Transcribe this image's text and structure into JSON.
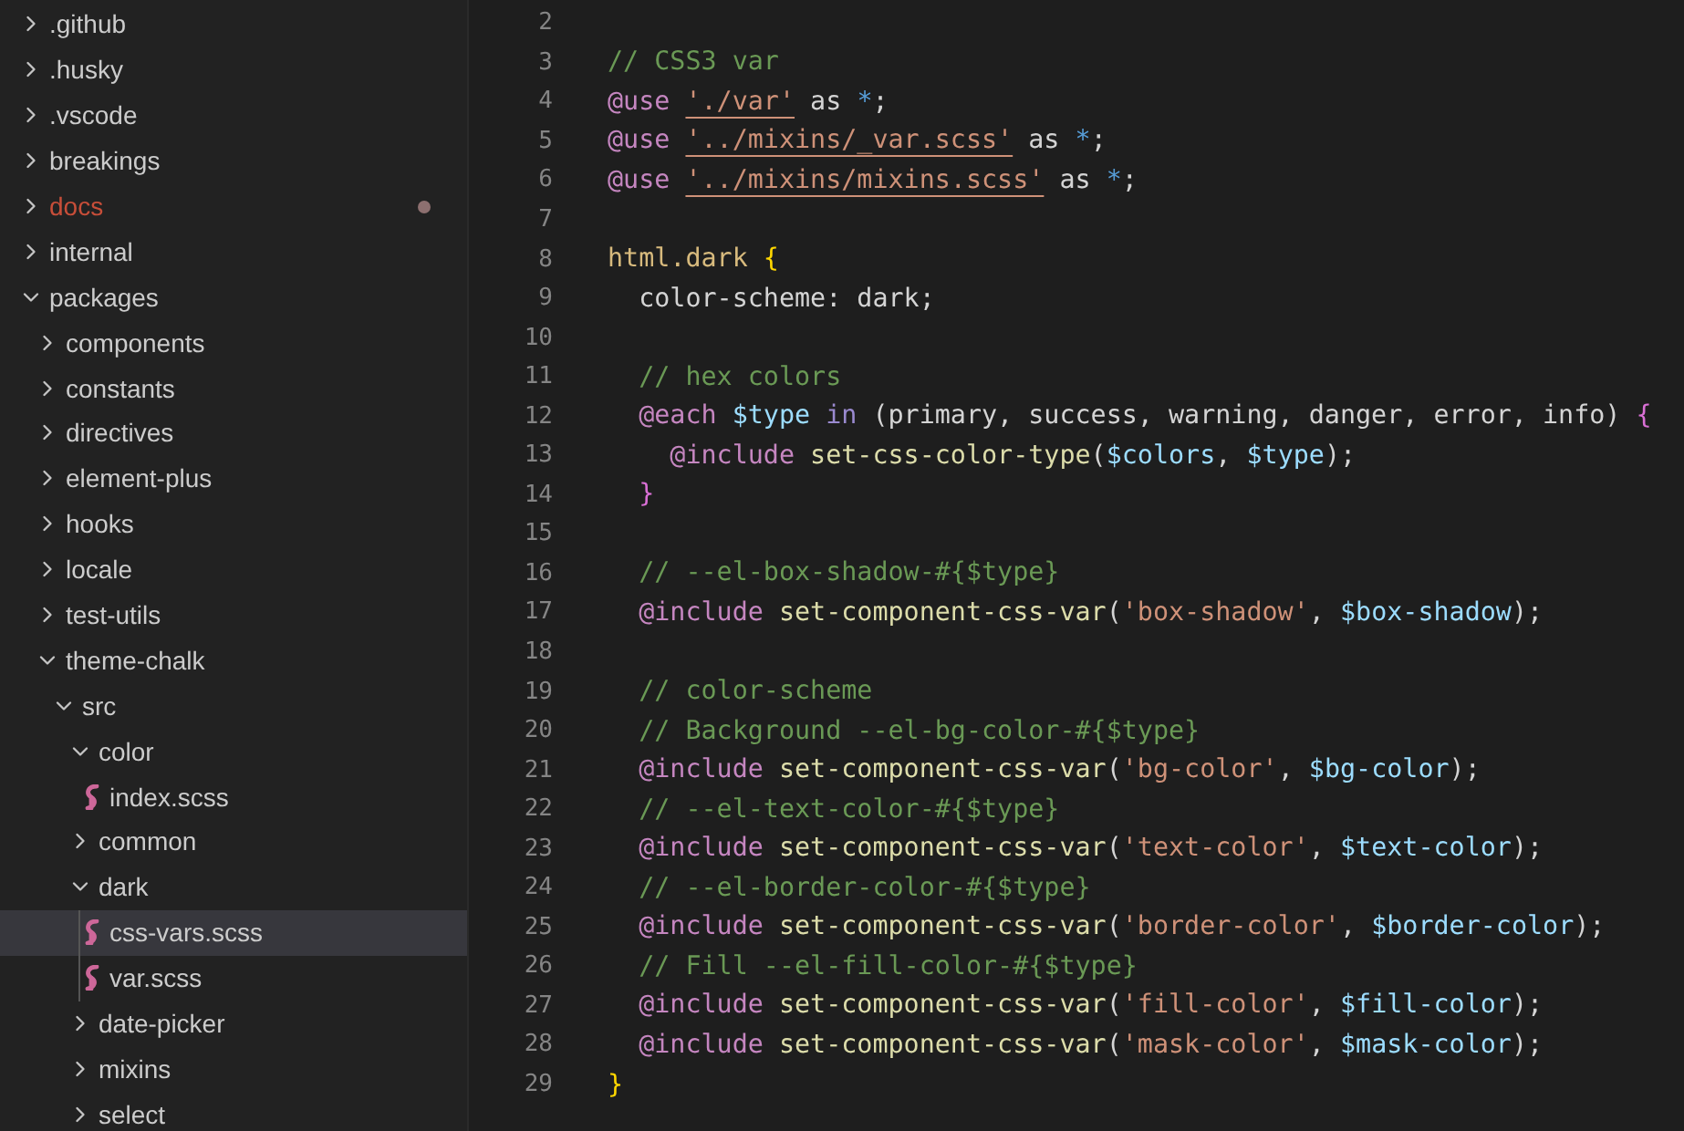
{
  "explorer": {
    "items": [
      {
        "name": ".github",
        "kind": "folder",
        "expanded": false,
        "modified": false,
        "selected": false
      },
      {
        "name": ".husky",
        "kind": "folder",
        "expanded": false,
        "modified": false,
        "selected": false
      },
      {
        "name": ".vscode",
        "kind": "folder",
        "expanded": false,
        "modified": false,
        "selected": false
      },
      {
        "name": "breakings",
        "kind": "folder",
        "expanded": false,
        "modified": false,
        "selected": false
      },
      {
        "name": "docs",
        "kind": "folder",
        "expanded": false,
        "modified": true,
        "selected": false
      },
      {
        "name": "internal",
        "kind": "folder",
        "expanded": false,
        "modified": false,
        "selected": false
      },
      {
        "name": "packages",
        "kind": "folder",
        "expanded": true,
        "modified": false,
        "selected": false,
        "children": [
          {
            "name": "components",
            "kind": "folder",
            "expanded": false,
            "modified": false,
            "selected": false
          },
          {
            "name": "constants",
            "kind": "folder",
            "expanded": false,
            "modified": false,
            "selected": false
          },
          {
            "name": "directives",
            "kind": "folder",
            "expanded": false,
            "modified": false,
            "selected": false
          },
          {
            "name": "element-plus",
            "kind": "folder",
            "expanded": false,
            "modified": false,
            "selected": false
          },
          {
            "name": "hooks",
            "kind": "folder",
            "expanded": false,
            "modified": false,
            "selected": false
          },
          {
            "name": "locale",
            "kind": "folder",
            "expanded": false,
            "modified": false,
            "selected": false
          },
          {
            "name": "test-utils",
            "kind": "folder",
            "expanded": false,
            "modified": false,
            "selected": false
          },
          {
            "name": "theme-chalk",
            "kind": "folder",
            "expanded": true,
            "modified": false,
            "selected": false,
            "children": [
              {
                "name": "src",
                "kind": "folder",
                "expanded": true,
                "modified": false,
                "selected": false,
                "children": [
                  {
                    "name": "color",
                    "kind": "folder",
                    "expanded": true,
                    "modified": false,
                    "selected": false,
                    "children": [
                      {
                        "name": "index.scss",
                        "kind": "file",
                        "modified": false,
                        "selected": false
                      }
                    ]
                  },
                  {
                    "name": "common",
                    "kind": "folder",
                    "expanded": false,
                    "modified": false,
                    "selected": false
                  },
                  {
                    "name": "dark",
                    "kind": "folder",
                    "expanded": true,
                    "modified": false,
                    "selected": false,
                    "children": [
                      {
                        "name": "css-vars.scss",
                        "kind": "file",
                        "modified": false,
                        "selected": true
                      },
                      {
                        "name": "var.scss",
                        "kind": "file",
                        "modified": false,
                        "selected": false
                      }
                    ]
                  },
                  {
                    "name": "date-picker",
                    "kind": "folder",
                    "expanded": false,
                    "modified": false,
                    "selected": false
                  },
                  {
                    "name": "mixins",
                    "kind": "folder",
                    "expanded": false,
                    "modified": false,
                    "selected": false
                  },
                  {
                    "name": "select",
                    "kind": "folder",
                    "expanded": false,
                    "modified": false,
                    "selected": false
                  }
                ]
              }
            ]
          }
        ]
      }
    ]
  },
  "editor": {
    "lines": [
      {
        "number": "2"
      },
      {
        "number": "3",
        "tokens": [
          {
            "t": "// CSS3 var",
            "kind": "comment"
          }
        ]
      },
      {
        "number": "4",
        "tokens": [
          {
            "t": "@use ",
            "kind": "at"
          },
          {
            "t": "'./var'",
            "kind": "link"
          },
          {
            "t": " as ",
            "kind": "plain"
          },
          {
            "t": "*",
            "kind": "op"
          },
          {
            "t": ";",
            "kind": "plain"
          }
        ]
      },
      {
        "number": "5",
        "tokens": [
          {
            "t": "@use ",
            "kind": "at"
          },
          {
            "t": "'../mixins/_var.scss'",
            "kind": "link"
          },
          {
            "t": " as ",
            "kind": "plain"
          },
          {
            "t": "*",
            "kind": "op"
          },
          {
            "t": ";",
            "kind": "plain"
          }
        ]
      },
      {
        "number": "6",
        "tokens": [
          {
            "t": "@use ",
            "kind": "at"
          },
          {
            "t": "'../mixins/mixins.scss'",
            "kind": "link"
          },
          {
            "t": " as ",
            "kind": "plain"
          },
          {
            "t": "*",
            "kind": "op"
          },
          {
            "t": ";",
            "kind": "plain"
          }
        ]
      },
      {
        "number": "7"
      },
      {
        "number": "8",
        "tokens": [
          {
            "t": "html.dark ",
            "kind": "selector"
          },
          {
            "t": "{",
            "kind": "brace"
          }
        ]
      },
      {
        "number": "9",
        "tokens": [
          {
            "t": "  color-scheme: dark;",
            "kind": "plain"
          }
        ]
      },
      {
        "number": "10"
      },
      {
        "number": "11",
        "tokens": [
          {
            "t": "  // hex colors",
            "kind": "comment"
          }
        ]
      },
      {
        "number": "12",
        "tokens": [
          {
            "t": "  @each ",
            "kind": "at"
          },
          {
            "t": "$type ",
            "kind": "var"
          },
          {
            "t": "in",
            "kind": "kw"
          },
          {
            "t": " (primary, success, warning, danger, error, info) ",
            "kind": "plain"
          },
          {
            "t": "{",
            "kind": "brace2"
          }
        ]
      },
      {
        "number": "13",
        "tokens": [
          {
            "t": "    @include ",
            "kind": "at"
          },
          {
            "t": "set-css-color-type",
            "kind": "fn"
          },
          {
            "t": "(",
            "kind": "plain"
          },
          {
            "t": "$colors",
            "kind": "var"
          },
          {
            "t": ", ",
            "kind": "plain"
          },
          {
            "t": "$type",
            "kind": "var"
          },
          {
            "t": ");",
            "kind": "plain"
          }
        ]
      },
      {
        "number": "14",
        "tokens": [
          {
            "t": "  }",
            "kind": "brace2"
          }
        ]
      },
      {
        "number": "15"
      },
      {
        "number": "16",
        "tokens": [
          {
            "t": "  // --el-box-shadow-#{$type}",
            "kind": "comment"
          }
        ]
      },
      {
        "number": "17",
        "tokens": [
          {
            "t": "  @include ",
            "kind": "at"
          },
          {
            "t": "set-component-css-var",
            "kind": "fn"
          },
          {
            "t": "(",
            "kind": "plain"
          },
          {
            "t": "'box-shadow'",
            "kind": "str"
          },
          {
            "t": ", ",
            "kind": "plain"
          },
          {
            "t": "$box-shadow",
            "kind": "var"
          },
          {
            "t": ");",
            "kind": "plain"
          }
        ]
      },
      {
        "number": "18"
      },
      {
        "number": "19",
        "tokens": [
          {
            "t": "  // color-scheme",
            "kind": "comment"
          }
        ]
      },
      {
        "number": "20",
        "tokens": [
          {
            "t": "  // Background --el-bg-color-#{$type}",
            "kind": "comment"
          }
        ]
      },
      {
        "number": "21",
        "tokens": [
          {
            "t": "  @include ",
            "kind": "at"
          },
          {
            "t": "set-component-css-var",
            "kind": "fn"
          },
          {
            "t": "(",
            "kind": "plain"
          },
          {
            "t": "'bg-color'",
            "kind": "str"
          },
          {
            "t": ", ",
            "kind": "plain"
          },
          {
            "t": "$bg-color",
            "kind": "var"
          },
          {
            "t": ");",
            "kind": "plain"
          }
        ]
      },
      {
        "number": "22",
        "tokens": [
          {
            "t": "  // --el-text-color-#{$type}",
            "kind": "comment"
          }
        ]
      },
      {
        "number": "23",
        "tokens": [
          {
            "t": "  @include ",
            "kind": "at"
          },
          {
            "t": "set-component-css-var",
            "kind": "fn"
          },
          {
            "t": "(",
            "kind": "plain"
          },
          {
            "t": "'text-color'",
            "kind": "str"
          },
          {
            "t": ", ",
            "kind": "plain"
          },
          {
            "t": "$text-color",
            "kind": "var"
          },
          {
            "t": ");",
            "kind": "plain"
          }
        ]
      },
      {
        "number": "24",
        "tokens": [
          {
            "t": "  // --el-border-color-#{$type}",
            "kind": "comment"
          }
        ]
      },
      {
        "number": "25",
        "tokens": [
          {
            "t": "  @include ",
            "kind": "at"
          },
          {
            "t": "set-component-css-var",
            "kind": "fn"
          },
          {
            "t": "(",
            "kind": "plain"
          },
          {
            "t": "'border-color'",
            "kind": "str"
          },
          {
            "t": ", ",
            "kind": "plain"
          },
          {
            "t": "$border-color",
            "kind": "var"
          },
          {
            "t": ");",
            "kind": "plain"
          }
        ]
      },
      {
        "number": "26",
        "tokens": [
          {
            "t": "  // Fill --el-fill-color-#{$type}",
            "kind": "comment"
          }
        ]
      },
      {
        "number": "27",
        "tokens": [
          {
            "t": "  @include ",
            "kind": "at"
          },
          {
            "t": "set-component-css-var",
            "kind": "fn"
          },
          {
            "t": "(",
            "kind": "plain"
          },
          {
            "t": "'fill-color'",
            "kind": "str"
          },
          {
            "t": ", ",
            "kind": "plain"
          },
          {
            "t": "$fill-color",
            "kind": "var"
          },
          {
            "t": ");",
            "kind": "plain"
          }
        ]
      },
      {
        "number": "28",
        "tokens": [
          {
            "t": "  @include ",
            "kind": "at"
          },
          {
            "t": "set-component-css-var",
            "kind": "fn"
          },
          {
            "t": "(",
            "kind": "plain"
          },
          {
            "t": "'mask-color'",
            "kind": "str"
          },
          {
            "t": ", ",
            "kind": "plain"
          },
          {
            "t": "$mask-color",
            "kind": "var"
          },
          {
            "t": ");",
            "kind": "plain"
          }
        ]
      },
      {
        "number": "29",
        "tokens": [
          {
            "t": "}",
            "kind": "brace"
          }
        ]
      }
    ]
  }
}
